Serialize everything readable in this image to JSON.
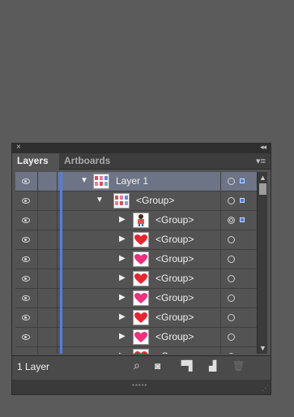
{
  "panel": {
    "close_glyph": "×",
    "collapse_glyph": "◂◂",
    "tabs": [
      {
        "label": "Layers",
        "active": true
      },
      {
        "label": "Artboards",
        "active": false
      }
    ],
    "menu_icon": "panel-menu-icon"
  },
  "rows": [
    {
      "label": "Layer 1",
      "thumb": "layer-thumb-icon",
      "expanded": true,
      "selected": true,
      "target": "single",
      "has_selection": true
    },
    {
      "label": "<Group>",
      "thumb": "group-thumb-icon",
      "expanded": true,
      "selected": false,
      "target": "single",
      "has_selection": true
    },
    {
      "label": "<Group>",
      "thumb": "figure-thumb-icon",
      "expanded": false,
      "selected": false,
      "target": "double",
      "has_selection": true
    },
    {
      "label": "<Group>",
      "thumb": "red-heart-icon",
      "expanded": false,
      "selected": false,
      "target": "single",
      "has_selection": false
    },
    {
      "label": "<Group>",
      "thumb": "pink-heart-icon",
      "expanded": false,
      "selected": false,
      "target": "single",
      "has_selection": false
    },
    {
      "label": "<Group>",
      "thumb": "red-heart-icon",
      "expanded": false,
      "selected": false,
      "target": "single",
      "has_selection": false
    },
    {
      "label": "<Group>",
      "thumb": "pink-heart-icon",
      "expanded": false,
      "selected": false,
      "target": "single",
      "has_selection": false
    },
    {
      "label": "<Group>",
      "thumb": "red-heart-icon",
      "expanded": false,
      "selected": false,
      "target": "single",
      "has_selection": false
    },
    {
      "label": "<Group>",
      "thumb": "pink-heart-icon",
      "expanded": false,
      "selected": false,
      "target": "single",
      "has_selection": false
    },
    {
      "label": "<Group>",
      "thumb": "red-heart-icon",
      "expanded": false,
      "selected": false,
      "target": "single",
      "has_selection": false
    }
  ],
  "footer": {
    "layer_count": "1 Layer",
    "icons": [
      "locate-object-icon",
      "make-clipping-mask-icon",
      "create-sublayer-icon",
      "create-new-layer-icon",
      "delete-icon"
    ]
  },
  "colors": {
    "layer_color": "#4f7fe8",
    "selected_row": "#6c7485",
    "red_heart": "#e8252f",
    "pink_heart": "#f0307a"
  }
}
